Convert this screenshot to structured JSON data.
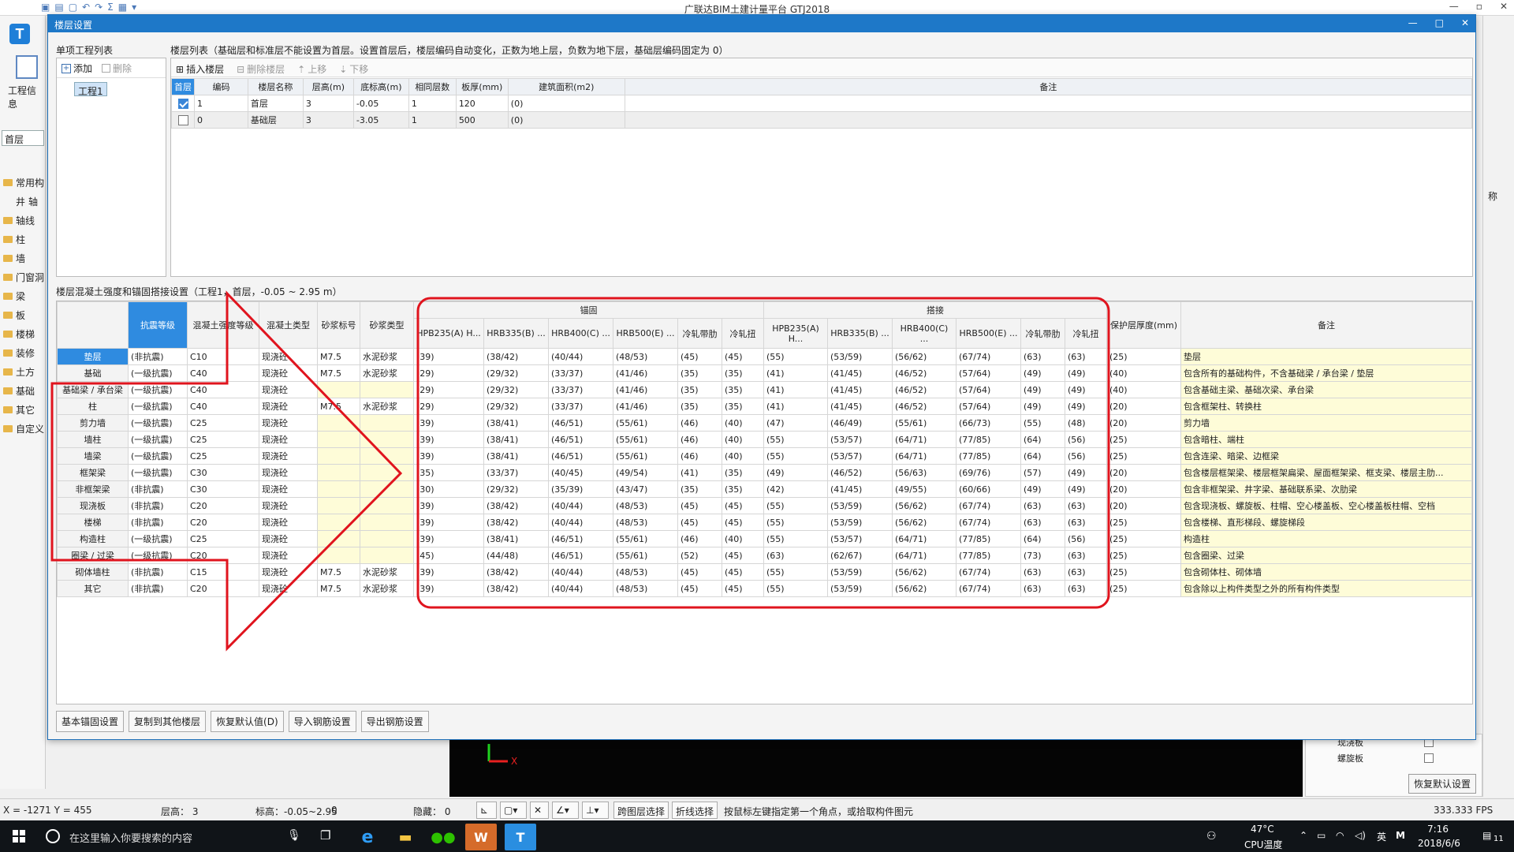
{
  "app": {
    "title": "广联达BIM土建计量平台 GTJ2018",
    "window_controls": [
      "—",
      "▫",
      "✕"
    ],
    "project_info_label": "工程信息",
    "floor_select": "首层",
    "nav_items": [
      "常用构",
      "轴",
      "轴线",
      "柱",
      "墙",
      "门窗洞",
      "梁",
      "板",
      "楼梯",
      "装修",
      "土方",
      "基础",
      "其它",
      "自定义"
    ],
    "right_partial_text": "称",
    "behind_panel": {
      "rows": [
        "现浇板",
        "螺旋板"
      ],
      "restore_button": "恢复默认设置"
    }
  },
  "dialog": {
    "title": "楼层设置",
    "controls": [
      "—",
      "□",
      "✕"
    ],
    "project_list_label": "单项工程列表",
    "add_label": "添加",
    "delete_label": "删除",
    "project_item": "工程1",
    "floor_list_label": "楼层列表（基础层和标准层不能设置为首层。设置首层后，楼层编码自动变化，正数为地上层，负数为地下层，基础层编码固定为 0）",
    "floor_toolbar": [
      "插入楼层",
      "删除楼层",
      "上移",
      "下移"
    ],
    "floor_headers": [
      "首层",
      "编码",
      "楼层名称",
      "层高(m)",
      "底标高(m)",
      "相同层数",
      "板厚(mm)",
      "建筑面积(m2)",
      "备注"
    ],
    "floors": [
      {
        "first": true,
        "code": "1",
        "name": "首层",
        "height": "3",
        "bottom": "-0.05",
        "same": "1",
        "slab": "120",
        "area": "(0)",
        "note": ""
      },
      {
        "first": false,
        "code": "0",
        "name": "基础层",
        "height": "3",
        "bottom": "-3.05",
        "same": "1",
        "slab": "500",
        "area": "(0)",
        "note": ""
      }
    ],
    "concrete_label": "楼层混凝土强度和锚固搭接设置（工程1，首层，-0.05 ~ 2.95 m）",
    "conc_headers_left": [
      "抗震等级",
      "混凝土强度等级",
      "混凝土类型",
      "砂浆标号",
      "砂浆类型"
    ],
    "group_anchor": "锚固",
    "group_lap": "搭接",
    "steel_headers": [
      "HPB235(A) H...",
      "HRB335(B) ...",
      "HRB400(C) ...",
      "HRB500(E) ...",
      "冷轧带肋",
      "冷轧扭"
    ],
    "cover_header": "保护层厚度(mm)",
    "note_header": "备注",
    "rows": [
      {
        "name": "垫层",
        "seis": "(非抗震)",
        "grade": "C10",
        "ctype": "现浇砼",
        "mortar": "M7.5",
        "mtype": "水泥砂浆",
        "anchor": [
          "(39)",
          "(38/42)",
          "(40/44)",
          "(48/53)",
          "(45)",
          "(45)"
        ],
        "lap": [
          "(55)",
          "(53/59)",
          "(56/62)",
          "(67/74)",
          "(63)",
          "(63)"
        ],
        "cover": "(25)",
        "note": "垫层"
      },
      {
        "name": "基础",
        "seis": "(一级抗震)",
        "grade": "C40",
        "ctype": "现浇砼",
        "mortar": "M7.5",
        "mtype": "水泥砂浆",
        "anchor": [
          "(29)",
          "(29/32)",
          "(33/37)",
          "(41/46)",
          "(35)",
          "(35)"
        ],
        "lap": [
          "(41)",
          "(41/45)",
          "(46/52)",
          "(57/64)",
          "(49)",
          "(49)"
        ],
        "cover": "(40)",
        "note": "包含所有的基础构件，不含基础梁 / 承台梁 / 垫层"
      },
      {
        "name": "基础梁 / 承台梁",
        "seis": "(一级抗震)",
        "grade": "C40",
        "ctype": "现浇砼",
        "mortar": "",
        "mtype": "",
        "anchor": [
          "(29)",
          "(29/32)",
          "(33/37)",
          "(41/46)",
          "(35)",
          "(35)"
        ],
        "lap": [
          "(41)",
          "(41/45)",
          "(46/52)",
          "(57/64)",
          "(49)",
          "(49)"
        ],
        "cover": "(40)",
        "note": "包含基础主梁、基础次梁、承台梁"
      },
      {
        "name": "柱",
        "seis": "(一级抗震)",
        "grade": "C40",
        "ctype": "现浇砼",
        "mortar": "M7.5",
        "mtype": "水泥砂浆",
        "anchor": [
          "(29)",
          "(29/32)",
          "(33/37)",
          "(41/46)",
          "(35)",
          "(35)"
        ],
        "lap": [
          "(41)",
          "(41/45)",
          "(46/52)",
          "(57/64)",
          "(49)",
          "(49)"
        ],
        "cover": "(20)",
        "note": "包含框架柱、转换柱"
      },
      {
        "name": "剪力墙",
        "seis": "(一级抗震)",
        "grade": "C25",
        "ctype": "现浇砼",
        "mortar": "",
        "mtype": "",
        "anchor": [
          "(39)",
          "(38/41)",
          "(46/51)",
          "(55/61)",
          "(46)",
          "(40)"
        ],
        "lap": [
          "(47)",
          "(46/49)",
          "(55/61)",
          "(66/73)",
          "(55)",
          "(48)"
        ],
        "cover": "(20)",
        "note": "剪力墙"
      },
      {
        "name": "墙柱",
        "seis": "(一级抗震)",
        "grade": "C25",
        "ctype": "现浇砼",
        "mortar": "",
        "mtype": "",
        "anchor": [
          "(39)",
          "(38/41)",
          "(46/51)",
          "(55/61)",
          "(46)",
          "(40)"
        ],
        "lap": [
          "(55)",
          "(53/57)",
          "(64/71)",
          "(77/85)",
          "(64)",
          "(56)"
        ],
        "cover": "(25)",
        "note": "包含暗柱、端柱"
      },
      {
        "name": "墙梁",
        "seis": "(一级抗震)",
        "grade": "C25",
        "ctype": "现浇砼",
        "mortar": "",
        "mtype": "",
        "anchor": [
          "(39)",
          "(38/41)",
          "(46/51)",
          "(55/61)",
          "(46)",
          "(40)"
        ],
        "lap": [
          "(55)",
          "(53/57)",
          "(64/71)",
          "(77/85)",
          "(64)",
          "(56)"
        ],
        "cover": "(25)",
        "note": "包含连梁、暗梁、边框梁"
      },
      {
        "name": "框架梁",
        "seis": "(一级抗震)",
        "grade": "C30",
        "ctype": "现浇砼",
        "mortar": "",
        "mtype": "",
        "anchor": [
          "(35)",
          "(33/37)",
          "(40/45)",
          "(49/54)",
          "(41)",
          "(35)"
        ],
        "lap": [
          "(49)",
          "(46/52)",
          "(56/63)",
          "(69/76)",
          "(57)",
          "(49)"
        ],
        "cover": "(20)",
        "note": "包含楼层框架梁、楼层框架扁梁、屋面框架梁、框支梁、楼层主肋..."
      },
      {
        "name": "非框架梁",
        "seis": "(非抗震)",
        "grade": "C30",
        "ctype": "现浇砼",
        "mortar": "",
        "mtype": "",
        "anchor": [
          "(30)",
          "(29/32)",
          "(35/39)",
          "(43/47)",
          "(35)",
          "(35)"
        ],
        "lap": [
          "(42)",
          "(41/45)",
          "(49/55)",
          "(60/66)",
          "(49)",
          "(49)"
        ],
        "cover": "(20)",
        "note": "包含非框架梁、井字梁、基础联系梁、次肋梁"
      },
      {
        "name": "现浇板",
        "seis": "(非抗震)",
        "grade": "C20",
        "ctype": "现浇砼",
        "mortar": "",
        "mtype": "",
        "anchor": [
          "(39)",
          "(38/42)",
          "(40/44)",
          "(48/53)",
          "(45)",
          "(45)"
        ],
        "lap": [
          "(55)",
          "(53/59)",
          "(56/62)",
          "(67/74)",
          "(63)",
          "(63)"
        ],
        "cover": "(20)",
        "note": "包含现浇板、螺旋板、柱帽、空心楼盖板、空心楼盖板柱帽、空档"
      },
      {
        "name": "楼梯",
        "seis": "(非抗震)",
        "grade": "C20",
        "ctype": "现浇砼",
        "mortar": "",
        "mtype": "",
        "anchor": [
          "(39)",
          "(38/42)",
          "(40/44)",
          "(48/53)",
          "(45)",
          "(45)"
        ],
        "lap": [
          "(55)",
          "(53/59)",
          "(56/62)",
          "(67/74)",
          "(63)",
          "(63)"
        ],
        "cover": "(25)",
        "note": "包含楼梯、直形梯段、螺旋梯段"
      },
      {
        "name": "构造柱",
        "seis": "(一级抗震)",
        "grade": "C25",
        "ctype": "现浇砼",
        "mortar": "",
        "mtype": "",
        "anchor": [
          "(39)",
          "(38/41)",
          "(46/51)",
          "(55/61)",
          "(46)",
          "(40)"
        ],
        "lap": [
          "(55)",
          "(53/57)",
          "(64/71)",
          "(77/85)",
          "(64)",
          "(56)"
        ],
        "cover": "(25)",
        "note": "构造柱"
      },
      {
        "name": "圈梁 / 过梁",
        "seis": "(一级抗震)",
        "grade": "C20",
        "ctype": "现浇砼",
        "mortar": "",
        "mtype": "",
        "anchor": [
          "(45)",
          "(44/48)",
          "(46/51)",
          "(55/61)",
          "(52)",
          "(45)"
        ],
        "lap": [
          "(63)",
          "(62/67)",
          "(64/71)",
          "(77/85)",
          "(73)",
          "(63)"
        ],
        "cover": "(25)",
        "note": "包含圈梁、过梁"
      },
      {
        "name": "砌体墙柱",
        "seis": "(非抗震)",
        "grade": "C15",
        "ctype": "现浇砼",
        "mortar": "M7.5",
        "mtype": "水泥砂浆",
        "anchor": [
          "(39)",
          "(38/42)",
          "(40/44)",
          "(48/53)",
          "(45)",
          "(45)"
        ],
        "lap": [
          "(55)",
          "(53/59)",
          "(56/62)",
          "(67/74)",
          "(63)",
          "(63)"
        ],
        "cover": "(25)",
        "note": "包含砌体柱、砌体墙"
      },
      {
        "name": "其它",
        "seis": "(非抗震)",
        "grade": "C20",
        "ctype": "现浇砼",
        "mortar": "M7.5",
        "mtype": "水泥砂浆",
        "anchor": [
          "(39)",
          "(38/42)",
          "(40/44)",
          "(48/53)",
          "(45)",
          "(45)"
        ],
        "lap": [
          "(55)",
          "(53/59)",
          "(56/62)",
          "(67/74)",
          "(63)",
          "(63)"
        ],
        "cover": "(25)",
        "note": "包含除以上构件类型之外的所有构件类型"
      }
    ],
    "bottom_buttons": [
      "基本锚固设置",
      "复制到其他楼层",
      "恢复默认值(D)",
      "导入钢筋设置",
      "导出钢筋设置"
    ]
  },
  "statusbar": {
    "coords": "X = -1271 Y = 455",
    "floor_height": "层高：   3",
    "elevation": "标高：-0.05~2.95",
    "zero": "0",
    "hidden": "隐藏：   0",
    "cross_floor": "跨图层选择",
    "polyline": "折线选择",
    "hint": "按鼠标左键指定第一个角点，或拾取构件图元",
    "fps": "333.333 FPS"
  },
  "taskbar": {
    "search_placeholder": "在这里输入你要搜索的内容",
    "temperature": "47°C",
    "cpu_label": "CPU温度",
    "ime": "英",
    "time": "7:16",
    "date": "2018/6/6",
    "notif_count": "11"
  },
  "annotation": {
    "color": "#e0141e"
  }
}
